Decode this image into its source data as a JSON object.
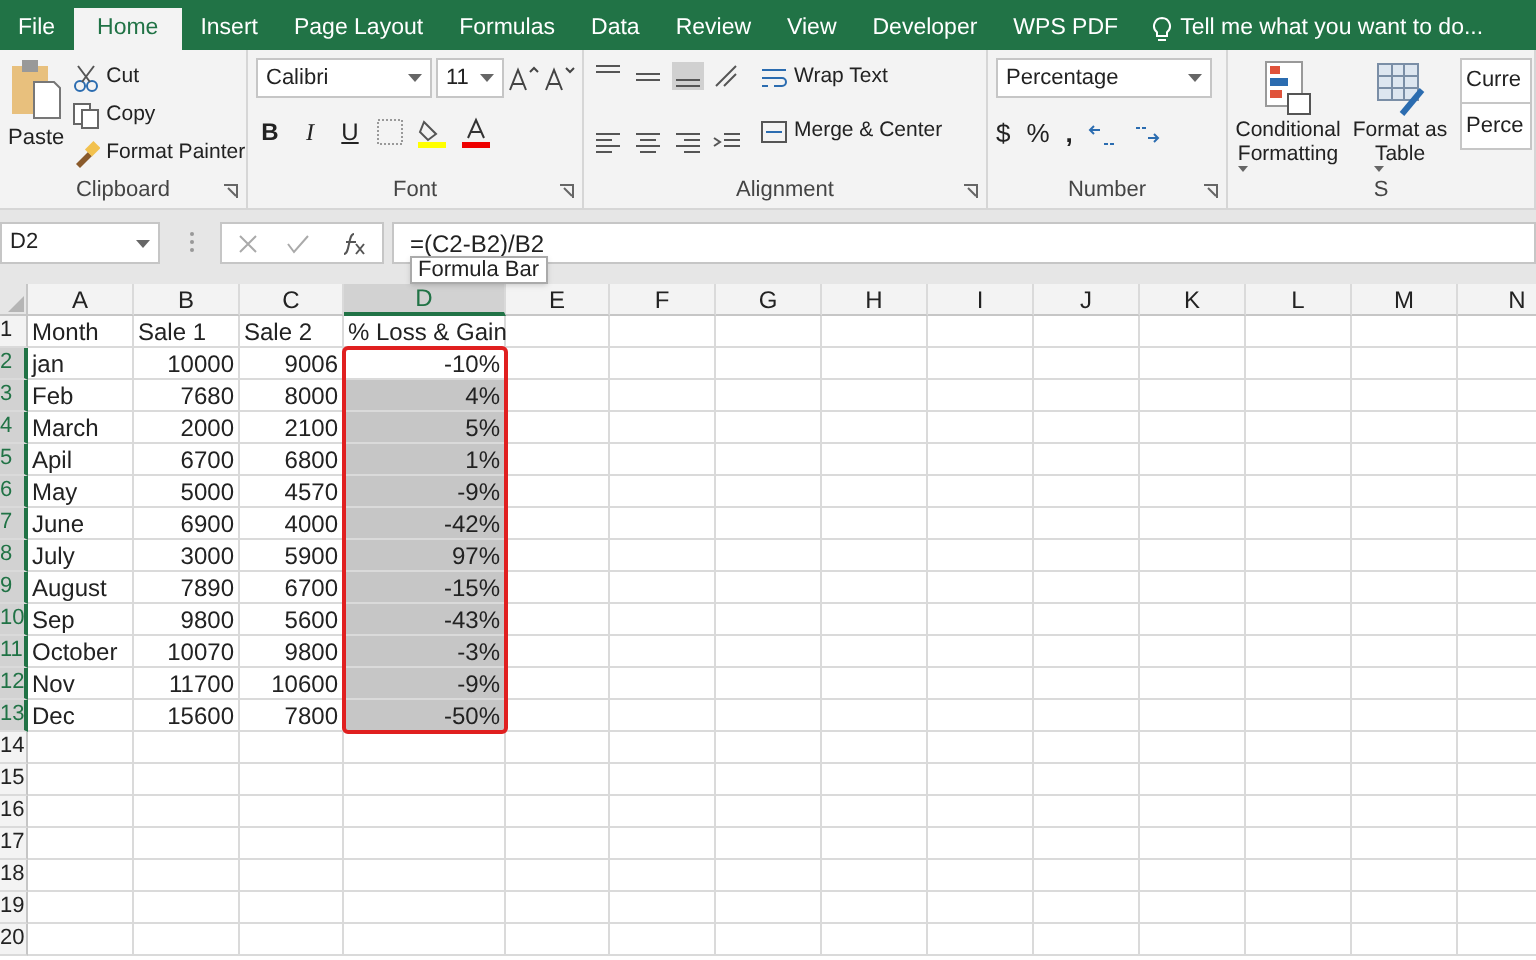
{
  "tabs": [
    {
      "label": "File",
      "selected": false
    },
    {
      "label": "Home",
      "selected": true
    },
    {
      "label": "Insert",
      "selected": false
    },
    {
      "label": "Page Layout",
      "selected": false
    },
    {
      "label": "Formulas",
      "selected": false
    },
    {
      "label": "Data",
      "selected": false
    },
    {
      "label": "Review",
      "selected": false
    },
    {
      "label": "View",
      "selected": false
    },
    {
      "label": "Developer",
      "selected": false
    },
    {
      "label": "WPS PDF",
      "selected": false
    }
  ],
  "tell_me": "Tell me what you want to do...",
  "clipboard": {
    "paste": "Paste",
    "cut": "Cut",
    "copy": "Copy",
    "format_painter": "Format Painter",
    "label": "Clipboard"
  },
  "font": {
    "name": "Calibri",
    "size": "11",
    "bold": "B",
    "italic": "I",
    "underline": "U",
    "label": "Font"
  },
  "alignment": {
    "wrap_text": "Wrap Text",
    "merge_center": "Merge & Center",
    "label": "Alignment"
  },
  "number": {
    "format": "Percentage",
    "currency": "$",
    "percent": "%",
    "comma": ",",
    "label": "Number"
  },
  "styles": {
    "conditional_formatting": [
      "Conditional",
      "Formatting"
    ],
    "format_as_table": [
      "Format as",
      "Table"
    ],
    "style_1": "Curre",
    "style_2": "Perce",
    "label": "S"
  },
  "name_box": "D2",
  "formula": "=(C2-B2)/B2",
  "tooltip": "Formula Bar",
  "selection_outlined": true,
  "columns": [
    {
      "label": "A",
      "selected": false
    },
    {
      "label": "B",
      "selected": false
    },
    {
      "label": "C",
      "selected": false
    },
    {
      "label": "D",
      "selected": true
    },
    {
      "label": "E",
      "selected": false
    },
    {
      "label": "F",
      "selected": false
    },
    {
      "label": "G",
      "selected": false
    },
    {
      "label": "H",
      "selected": false
    },
    {
      "label": "I",
      "selected": false
    },
    {
      "label": "J",
      "selected": false
    },
    {
      "label": "K",
      "selected": false
    },
    {
      "label": "L",
      "selected": false
    },
    {
      "label": "M",
      "selected": false
    },
    {
      "label": "N",
      "selected": false
    }
  ],
  "rows": [
    {
      "header": "1",
      "kind": "header",
      "selected": false,
      "cells": [
        "Month",
        "Sale 1",
        "Sale 2",
        "% Loss & Gain"
      ]
    },
    {
      "header": "2",
      "kind": "data",
      "selected": true,
      "active": true,
      "cells": [
        "jan",
        "10000",
        "9006",
        "-10%"
      ]
    },
    {
      "header": "3",
      "kind": "data",
      "selected": true,
      "cells": [
        "Feb",
        "7680",
        "8000",
        "4%"
      ]
    },
    {
      "header": "4",
      "kind": "data",
      "selected": true,
      "cells": [
        "March",
        "2000",
        "2100",
        "5%"
      ]
    },
    {
      "header": "5",
      "kind": "data",
      "selected": true,
      "cells": [
        "Apil",
        "6700",
        "6800",
        "1%"
      ]
    },
    {
      "header": "6",
      "kind": "data",
      "selected": true,
      "cells": [
        "May",
        "5000",
        "4570",
        "-9%"
      ]
    },
    {
      "header": "7",
      "kind": "data",
      "selected": true,
      "cells": [
        "June",
        "6900",
        "4000",
        "-42%"
      ]
    },
    {
      "header": "8",
      "kind": "data",
      "selected": true,
      "cells": [
        "July",
        "3000",
        "5900",
        "97%"
      ]
    },
    {
      "header": "9",
      "kind": "data",
      "selected": true,
      "cells": [
        "August",
        "7890",
        "6700",
        "-15%"
      ]
    },
    {
      "header": "10",
      "kind": "data",
      "selected": true,
      "cells": [
        "Sep",
        "9800",
        "5600",
        "-43%"
      ]
    },
    {
      "header": "11",
      "kind": "data",
      "selected": true,
      "cells": [
        "October",
        "10070",
        "9800",
        "-3%"
      ]
    },
    {
      "header": "12",
      "kind": "data",
      "selected": true,
      "cells": [
        "Nov",
        "11700",
        "10600",
        "-9%"
      ]
    },
    {
      "header": "13",
      "kind": "data",
      "selected": true,
      "cells": [
        "Dec",
        "15600",
        "7800",
        "-50%"
      ]
    },
    {
      "header": "14",
      "kind": "data",
      "selected": false,
      "cells": []
    },
    {
      "header": "15",
      "kind": "data",
      "selected": false,
      "cells": []
    },
    {
      "header": "16",
      "kind": "data",
      "selected": false,
      "cells": []
    },
    {
      "header": "17",
      "kind": "data",
      "selected": false,
      "cells": []
    },
    {
      "header": "18",
      "kind": "data",
      "selected": false,
      "cells": []
    },
    {
      "header": "19",
      "kind": "data",
      "selected": false,
      "cells": []
    },
    {
      "header": "20",
      "kind": "data",
      "selected": false,
      "cells": []
    }
  ]
}
